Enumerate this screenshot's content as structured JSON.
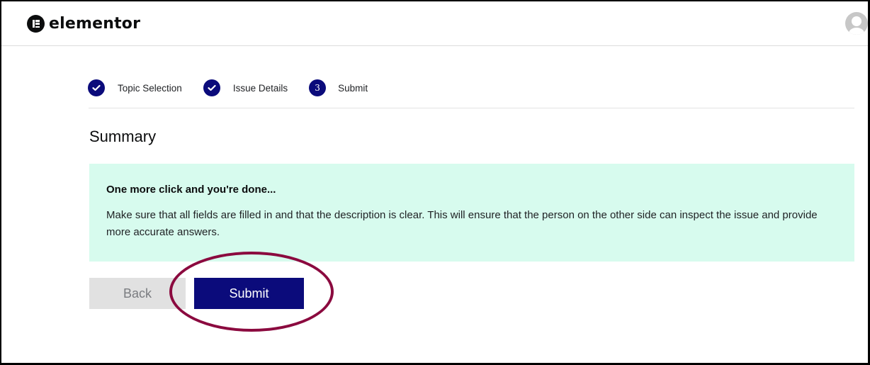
{
  "header": {
    "logo_text": "elementor",
    "logo_icon": "elementor-logo-icon",
    "avatar_icon": "user-avatar-icon"
  },
  "steps": [
    {
      "label": "Topic Selection",
      "status": "completed",
      "icon": "check-icon",
      "marker": ""
    },
    {
      "label": "Issue Details",
      "status": "completed",
      "icon": "check-icon",
      "marker": ""
    },
    {
      "label": "Submit",
      "status": "current",
      "icon": "",
      "marker": "3"
    }
  ],
  "main": {
    "title": "Summary",
    "notice": {
      "heading": "One more click and you're done...",
      "body": "Make sure that all fields are filled in and that the description is clear. This will ensure that the person on the other side can inspect the issue and provide more accurate answers."
    },
    "buttons": {
      "back_label": "Back",
      "submit_label": "Submit"
    }
  },
  "colors": {
    "primary": "#0b0b7b",
    "notice_bg": "#d7fbee",
    "highlight": "#8b0a3f",
    "back_bg": "#e1e1e1"
  }
}
